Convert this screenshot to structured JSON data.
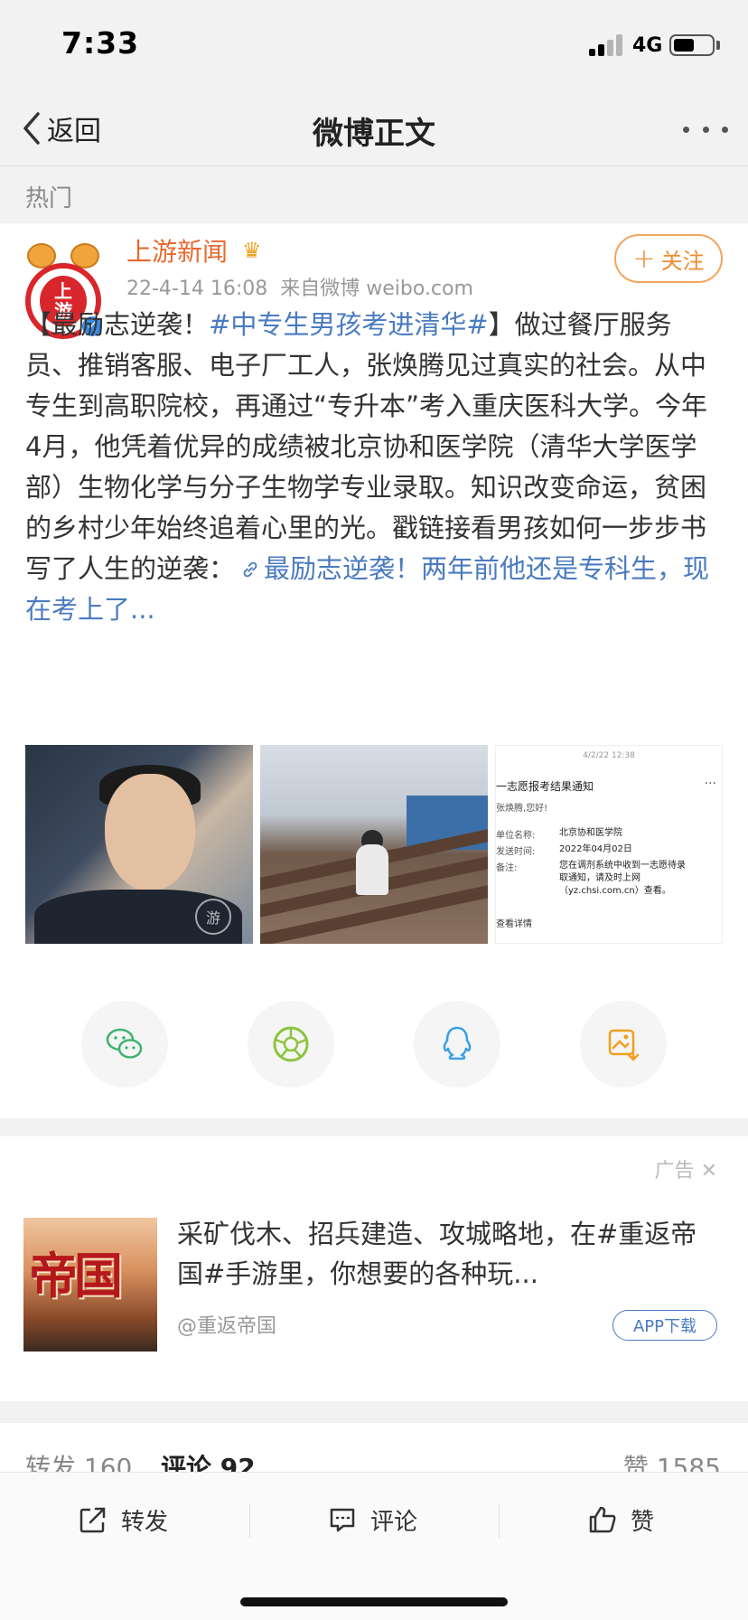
{
  "status_bar": {
    "time": "7:33",
    "network": "4G"
  },
  "nav": {
    "back_label": "返回",
    "title": "微博正文"
  },
  "hot_label": "热门",
  "post": {
    "avatar_text_1": "上",
    "avatar_text_2": "游",
    "author": "上游新闻",
    "date": "22-4-14 16:08",
    "source": "来自微博 weibo.com",
    "follow_label": "关注",
    "text_open": "【最励志逆袭！",
    "hashtag": "#中专生男孩考进清华#",
    "text_body": "】做过餐厅服务员、推销客服、电子厂工人，张焕腾见过真实的社会。从中专生到高职院校，再通过“专升本”考入重庆医科大学。今年4月，他凭着优异的成绩被北京协和医学院（清华大学医学部）生物化学与分子生物学专业录取。知识改变命运，贫困的乡村少年始终追着心里的光。戳链接看男孩如何一步步书写了人生的逆袭：",
    "link_text": "最励志逆袭！两年前他还是专科生，现在考上了...",
    "photo3": {
      "timestamp": "4/2/22 12:38",
      "header": "一志愿报考结果通知",
      "greeting": "张焕腾,您好!",
      "unit_label": "单位名称:",
      "unit_value": "北京协和医学院",
      "sent_label": "发送时间:",
      "sent_value": "2022年04月02日",
      "note_label": "备注:",
      "note_value": "您在调剂系统中收到一志愿待录取通知，请及时上网（yz.chsi.com.cn）查看。",
      "detail": "查看详情"
    }
  },
  "share_icons": [
    "wechat-icon",
    "moments-icon",
    "qq-icon",
    "save-image-icon"
  ],
  "ad": {
    "label": "广告",
    "image_text": "帝国",
    "text": "采矿伐木、招兵建造、攻城略地，在#重返帝国#手游里，你想要的各种玩...",
    "source": "@重返帝国",
    "button": "APP下载"
  },
  "counts": {
    "repost": "转发 160",
    "comment": "评论 92",
    "like": "赞 1585"
  },
  "toolbar": {
    "repost": "转发",
    "comment": "评论",
    "like": "赞"
  },
  "colors": {
    "accent_orange": "#e8692f",
    "link_blue": "#4a7bc0",
    "wechat_green": "#3fb36e",
    "qq_blue": "#3a9fe6",
    "save_orange": "#f0a020"
  }
}
